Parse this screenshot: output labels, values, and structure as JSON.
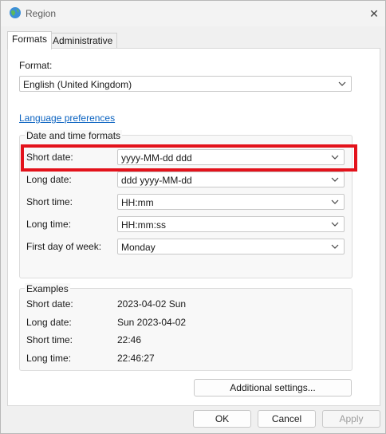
{
  "window": {
    "title": "Region",
    "close_icon": "close-icon"
  },
  "tabs": [
    {
      "label": "Formats",
      "active": true
    },
    {
      "label": "Administrative",
      "active": false
    }
  ],
  "format": {
    "label": "Format:",
    "value": "English (United Kingdom)"
  },
  "language_link": "Language preferences",
  "date_time": {
    "title": "Date and time formats",
    "rows": [
      {
        "label": "Short date:",
        "value": "yyyy-MM-dd ddd"
      },
      {
        "label": "Long date:",
        "value": "ddd yyyy-MM-dd"
      },
      {
        "label": "Short time:",
        "value": "HH:mm"
      },
      {
        "label": "Long time:",
        "value": "HH:mm:ss"
      },
      {
        "label": "First day of week:",
        "value": "Monday"
      }
    ]
  },
  "examples": {
    "title": "Examples",
    "rows": [
      {
        "label": "Short date:",
        "value": "2023-04-02 Sun"
      },
      {
        "label": "Long date:",
        "value": "Sun 2023-04-02"
      },
      {
        "label": "Short time:",
        "value": "22:46"
      },
      {
        "label": "Long time:",
        "value": "22:46:27"
      }
    ]
  },
  "buttons": {
    "additional": "Additional settings...",
    "ok": "OK",
    "cancel": "Cancel",
    "apply": "Apply"
  },
  "colors": {
    "highlight": "#e3121b",
    "link": "#0b63c1"
  }
}
